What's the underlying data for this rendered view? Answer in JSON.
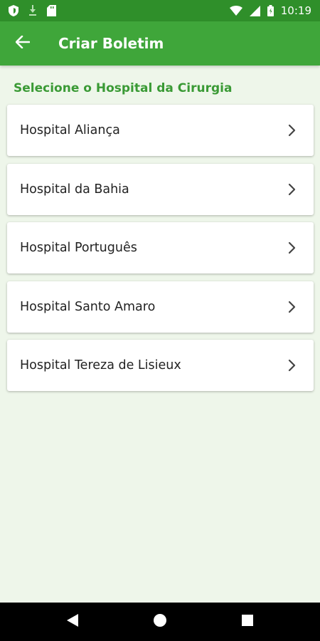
{
  "status_bar": {
    "time": "10:19",
    "left_icons": [
      "shield-icon",
      "download-icon",
      "sd-card-icon"
    ],
    "right_icons": [
      "wifi-icon",
      "signal-icon",
      "battery-icon"
    ]
  },
  "app_bar": {
    "title": "Criar Boletim",
    "back_icon": "arrow-back-icon"
  },
  "section_title": "Selecione o Hospital da Cirurgia",
  "hospitals": [
    {
      "name": "Hospital Aliança"
    },
    {
      "name": "Hospital da Bahia"
    },
    {
      "name": "Hospital Português"
    },
    {
      "name": "Hospital Santo Amaro"
    },
    {
      "name": "Hospital Tereza de Lisieux"
    }
  ],
  "nav_bar": {
    "buttons": [
      "back-triangle-icon",
      "home-circle-icon",
      "recents-square-icon"
    ]
  },
  "colors": {
    "status_bar": "#2f8f2a",
    "app_bar": "#3fa63a",
    "accent_text": "#3a9a35",
    "background": "#eef6ea"
  }
}
